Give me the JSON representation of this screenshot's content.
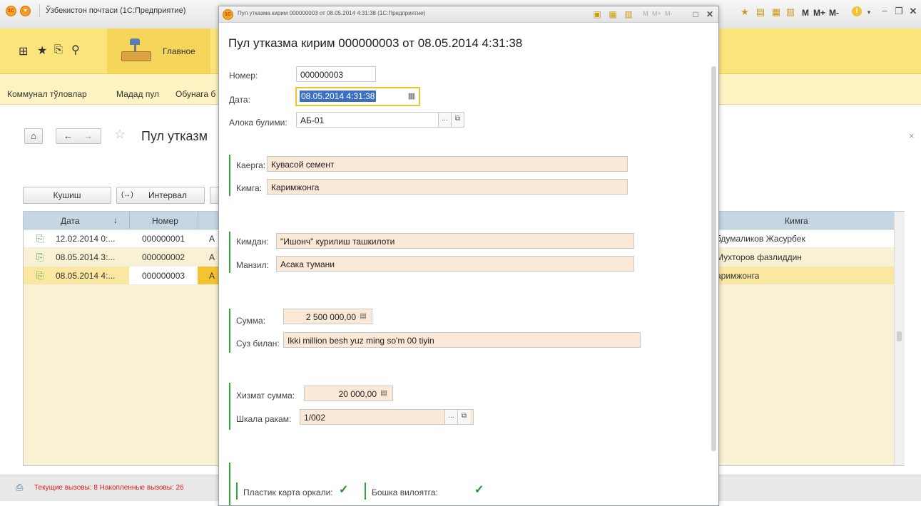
{
  "main_window": {
    "title": "Ўзбекистон почтаси (1С:Предприятие)",
    "right_toolbar": [
      "M",
      "M+",
      "M-"
    ]
  },
  "sections": {
    "main_label": "Главное"
  },
  "nav_links": [
    "Коммунал тўловлар",
    "Мадад пул",
    "Обунага б"
  ],
  "list_page": {
    "title": "Пул утказм",
    "buttons": {
      "create": "Кушиш",
      "interval": "Интервал"
    },
    "columns": {
      "date": "Дата",
      "number": "Номер",
      "kimga": "Кимга"
    },
    "sort_indicator": "↓",
    "rows": [
      {
        "date": "12.02.2014 0:...",
        "number": "000000001",
        "trunc": "А",
        "kimga": "бдумаликов Жасурбек"
      },
      {
        "date": "08.05.2014 3:...",
        "number": "000000002",
        "trunc": "А",
        "kimga": "Мухторов фазлиддин"
      },
      {
        "date": "08.05.2014 4:...",
        "number": "000000003",
        "trunc": "А",
        "kimga": "аримжонга"
      }
    ]
  },
  "status": {
    "text": "Текущие вызовы: 8  Накопленные вызовы: 26"
  },
  "dialog": {
    "window_title": "Пул утказма кирим 000000003 от 08.05.2014 4:31:38  (1С:Предприятие)",
    "heading": "Пул утказма кирим 000000003 от 08.05.2014 4:31:38",
    "toolbar_labels": [
      "M",
      "M+",
      "M-"
    ],
    "fields": {
      "number_label": "Номер:",
      "number_value": "000000003",
      "date_label": "Дата:",
      "date_value": "08.05.2014  4:31:38",
      "branch_label": "Алока булими:",
      "branch_value": "АБ-01",
      "kaerga_label": "Каерга:",
      "kaerga_value": "Кувасой семент",
      "kimga_label": "Кимга:",
      "kimga_value": "Каримжонга",
      "kimdan_label": "Кимдан:",
      "kimdan_value": "\"Ишонч\" курилиш ташкилоти",
      "manzil_label": "Манзил:",
      "manzil_value": "Асака тумани",
      "summa_label": "Сумма:",
      "summa_value": "2 500 000,00",
      "words_label": "Суз билан:",
      "words_value": "Ikki million besh yuz ming so'm 00 tiyin",
      "service_label": "Хизмат сумма:",
      "service_value": "20 000,00",
      "scale_label": "Шкала ракам:",
      "scale_value": "1/002",
      "card_label": "Пластик карта оркали:",
      "region_label": "Бошка вилоятга:"
    },
    "ellipsis": "...",
    "close_x": "×"
  },
  "colors": {
    "section_yellow": "#fce47d",
    "field_bg": "#fbe9d8",
    "selection": "#3a6fc4",
    "green_bar": "#2ea836"
  }
}
